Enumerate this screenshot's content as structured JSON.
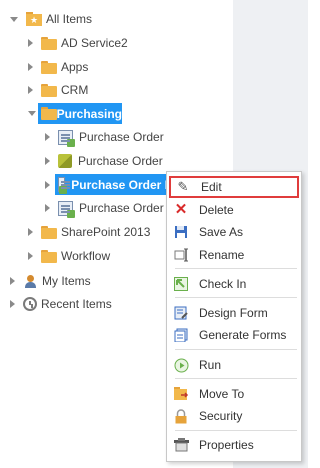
{
  "tree": {
    "root": {
      "label": "All Items",
      "icon": "all-items-icon"
    },
    "items": [
      {
        "label": "AD Service2",
        "icon": "folder-icon"
      },
      {
        "label": "Apps",
        "icon": "folder-icon"
      },
      {
        "label": "CRM",
        "icon": "folder-icon"
      },
      {
        "label": "Purchasing",
        "icon": "folder-icon"
      },
      {
        "label": "SharePoint 2013",
        "icon": "folder-icon"
      },
      {
        "label": "Workflow",
        "icon": "folder-icon"
      }
    ],
    "purchasing_children": [
      {
        "label": "Purchase Order",
        "icon": "form-icon"
      },
      {
        "label": "Purchase Order",
        "icon": "smartobject-icon"
      },
      {
        "label": "Purchase Order I",
        "icon": "form-icon"
      },
      {
        "label": "Purchase Order L",
        "icon": "form-icon"
      }
    ],
    "bottom": [
      {
        "label": "My Items",
        "icon": "user-icon"
      },
      {
        "label": "Recent Items",
        "icon": "clock-icon"
      }
    ]
  },
  "context_menu": {
    "items": [
      {
        "label": "Edit",
        "icon": "pencil-icon",
        "color": "#555555"
      },
      {
        "label": "Delete",
        "icon": "delete-x-icon",
        "color": "#d92b2b"
      },
      {
        "label": "Save As",
        "icon": "save-icon",
        "color": "#3b6ec2"
      },
      {
        "label": "Rename",
        "icon": "rename-icon",
        "color": "#7a7a7a"
      },
      {
        "label": "Check In",
        "icon": "check-in-icon",
        "color": "#6ab04c"
      },
      {
        "label": "Design Form",
        "icon": "design-form-icon",
        "color": "#3b6ec2"
      },
      {
        "label": "Generate Forms",
        "icon": "generate-forms-icon",
        "color": "#3b6ec2"
      },
      {
        "label": "Run",
        "icon": "run-icon",
        "color": "#6ab04c"
      },
      {
        "label": "Move To",
        "icon": "move-to-icon",
        "color": "#e6a33b"
      },
      {
        "label": "Security",
        "icon": "lock-icon",
        "color": "#e6a33b"
      },
      {
        "label": "Properties",
        "icon": "properties-icon",
        "color": "#555555"
      }
    ],
    "highlighted_item": "Edit",
    "highlight_color": "#e03c3c"
  },
  "colors": {
    "selection": "#2196f3",
    "folder": "#f2b84b",
    "side_panel": "#eef0f3"
  }
}
